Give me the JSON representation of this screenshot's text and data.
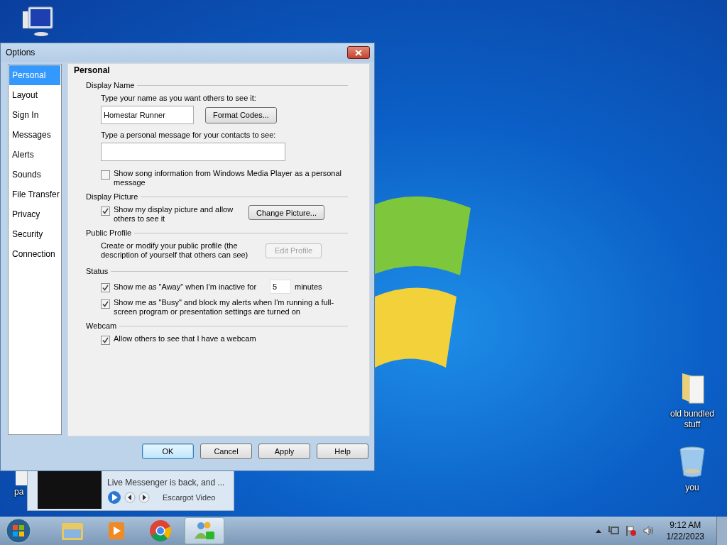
{
  "desktop_icons": [
    {
      "kind": "computer"
    },
    {
      "kind": "folder",
      "label": "old bundled stuff"
    },
    {
      "kind": "recycle-bin",
      "label": "you"
    },
    {
      "kind": "file",
      "label": "pa"
    }
  ],
  "dialog": {
    "title": "Options",
    "sidebar": [
      {
        "label": "Personal",
        "selected": true
      },
      {
        "label": "Layout",
        "selected": false
      },
      {
        "label": "Sign In",
        "selected": false
      },
      {
        "label": "Messages",
        "selected": false
      },
      {
        "label": "Alerts",
        "selected": false
      },
      {
        "label": "Sounds",
        "selected": false
      },
      {
        "label": "File Transfer",
        "selected": false
      },
      {
        "label": "Privacy",
        "selected": false
      },
      {
        "label": "Security",
        "selected": false
      },
      {
        "label": "Connection",
        "selected": false
      }
    ],
    "section_title": "Personal",
    "groups": [
      {
        "title": "Display Name",
        "items": [
          {
            "kind": "label",
            "text": "Type your name as you want others to see it:"
          },
          {
            "kind": "field-button",
            "value": "Homestar Runner",
            "button": {
              "label": "Format Codes...",
              "disabled": false
            }
          },
          {
            "kind": "label",
            "text": "Type a personal message for your contacts to see:"
          },
          {
            "kind": "field"
          },
          {
            "kind": "checkbox",
            "label": "Show song information from Windows Media Player as a personal message",
            "checked": false
          }
        ]
      },
      {
        "title": "Display Picture",
        "items": [
          {
            "kind": "checkbox-button",
            "label": "Show my display picture and allow others to see it",
            "checked": true,
            "button": {
              "label": "Change Picture...",
              "disabled": false
            }
          }
        ]
      },
      {
        "title": "Public Profile",
        "items": [
          {
            "kind": "text-button",
            "text": "Create or modify your public profile (the description of yourself that others can see)",
            "button": {
              "label": "Edit Profile",
              "disabled": true
            }
          }
        ]
      },
      {
        "title": "Status",
        "items": [
          {
            "kind": "checkbox-number",
            "label": "Show me as \"Away\" when I'm inactive for",
            "checked": true,
            "value": "5",
            "unit": "minutes"
          },
          {
            "kind": "checkbox",
            "label": "Show me as \"Busy\" and block my alerts when I'm running a full-screen program or presentation settings are turned on",
            "checked": true
          }
        ]
      },
      {
        "title": "Webcam",
        "items": [
          {
            "kind": "checkbox",
            "label": "Allow others to see that I have a webcam",
            "checked": true
          }
        ]
      }
    ],
    "buttons": [
      {
        "label": "OK",
        "default": true
      },
      {
        "label": "Cancel",
        "default": false
      },
      {
        "label": "Apply",
        "default": false
      },
      {
        "label": "Help",
        "default": false
      }
    ]
  },
  "notification": {
    "text": "Live Messenger is back, and ...",
    "source": "Escargot Video"
  },
  "taskbar": {
    "items": [
      {
        "kind": "explorer",
        "selected": false
      },
      {
        "kind": "media-player",
        "selected": false
      },
      {
        "kind": "chrome",
        "selected": false
      },
      {
        "kind": "messenger",
        "selected": true
      }
    ],
    "time": "9:12 AM",
    "date": "1/22/2023"
  }
}
